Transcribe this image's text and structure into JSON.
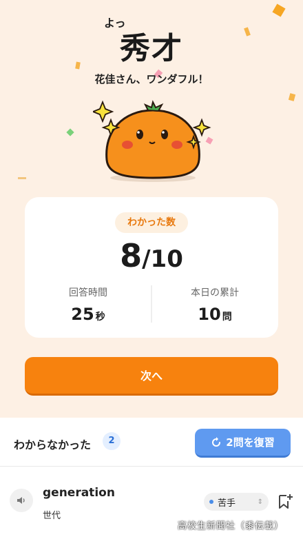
{
  "result": {
    "ruby": "よっ",
    "title": "秀才",
    "subtitle": "花佳さん、ワンダフル！"
  },
  "score_card": {
    "label": "わかった数",
    "correct": "8",
    "slash": "/",
    "total": "10",
    "answer_time": {
      "label": "回答時間",
      "value": "25",
      "unit": "秒"
    },
    "today_total": {
      "label": "本日の累計",
      "value": "10",
      "unit": "問"
    }
  },
  "next_button": "次へ",
  "wrong_section": {
    "title": "わからなかった",
    "count": "2",
    "review_button": "2問を復習"
  },
  "words": [
    {
      "word": "generation",
      "meaning": "世代",
      "tag": "苦手"
    }
  ],
  "watermark": "高校生新聞社（黍伝載）",
  "colors": {
    "background": "#fdf0e4",
    "accent_orange": "#f7820e",
    "review_blue": "#5f9af0",
    "mascot": "#f6901c"
  },
  "icons": [
    "speaker-icon",
    "bookmark-add-icon",
    "refresh-icon",
    "chevron-updown-icon",
    "sparkle-icon",
    "mascot-orange"
  ]
}
